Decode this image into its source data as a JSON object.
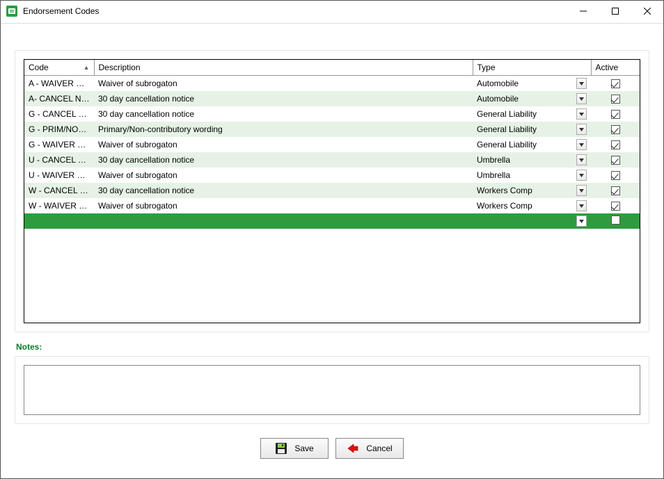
{
  "window": {
    "title": "Endorsement Codes"
  },
  "grid": {
    "columns": {
      "code": "Code",
      "description": "Description",
      "type": "Type",
      "active": "Active"
    },
    "rows": [
      {
        "code": "A - WAIVER OF ...",
        "description": "Waiver of subrogaton",
        "type": "Automobile",
        "active": true
      },
      {
        "code": "A- CANCEL NOTI...",
        "description": "30 day cancellation notice",
        "type": "Automobile",
        "active": true
      },
      {
        "code": "G - CANCEL NO...",
        "description": "30 day cancellation notice",
        "type": "General Liability",
        "active": true
      },
      {
        "code": "G - PRIM/NON C...",
        "description": "Primary/Non-contributory wording",
        "type": "General Liability",
        "active": true
      },
      {
        "code": "G - WAIVER OF ...",
        "description": "Waiver of subrogaton",
        "type": "General Liability",
        "active": true
      },
      {
        "code": "U - CANCEL NO...",
        "description": "30 day cancellation notice",
        "type": "Umbrella",
        "active": true
      },
      {
        "code": "U - WAIVER OF ...",
        "description": "Waiver of subrogaton",
        "type": "Umbrella",
        "active": true
      },
      {
        "code": "W - CANCEL NO...",
        "description": "30 day cancellation notice",
        "type": "Workers Comp",
        "active": true
      },
      {
        "code": "W - WAIVER OF ...",
        "description": "Waiver of subrogaton",
        "type": "Workers Comp",
        "active": true
      }
    ]
  },
  "notes": {
    "label": "Notes:",
    "value": ""
  },
  "buttons": {
    "save": "Save",
    "cancel": "Cancel"
  }
}
